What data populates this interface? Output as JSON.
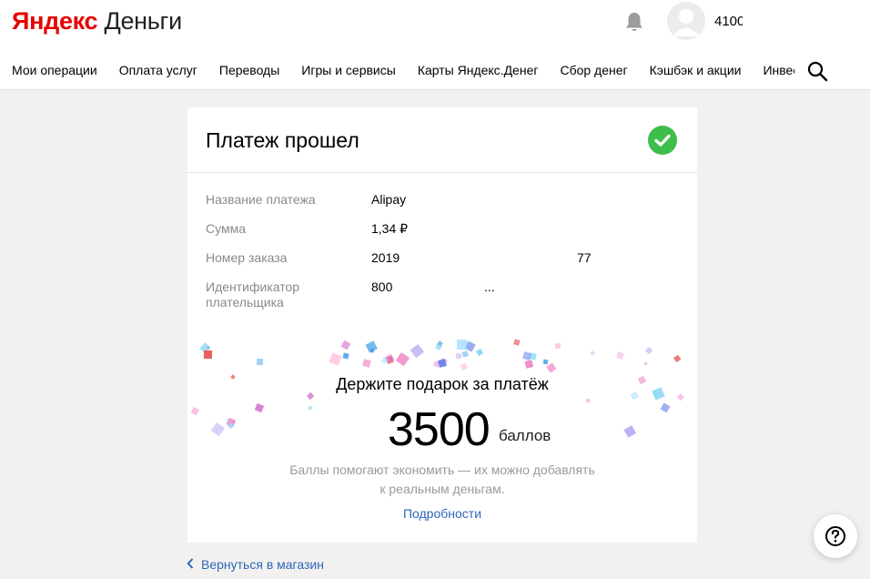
{
  "header": {
    "logo_brand": "Яндекс",
    "logo_product": "Деньги",
    "account_number": "4100",
    "icons": {
      "bell": "bell-icon",
      "avatar": "avatar",
      "search": "search-icon"
    }
  },
  "nav": {
    "items": [
      "Мои операции",
      "Оплата услуг",
      "Переводы",
      "Игры и сервисы",
      "Карты Яндекс.Денег",
      "Сбор денег",
      "Кэшбэк и акции",
      "Инвестиции"
    ]
  },
  "payment": {
    "title": "Платеж прошел",
    "status_icon": "check-circle-icon",
    "status_color": "#3dbd4a",
    "rows": [
      {
        "label": "Название платежа",
        "value": "Alipay"
      },
      {
        "label": "Сумма",
        "value": "1,34 ₽"
      },
      {
        "label": "Номер заказа",
        "value": "2019",
        "extra": "77"
      },
      {
        "label": "Идентификатор плательщика",
        "value": "800",
        "extra": "..."
      }
    ]
  },
  "gift": {
    "title": "Держите подарок за платёж",
    "points": "3500",
    "points_unit": "баллов",
    "description_line1": "Баллы помогают экономить — их можно добавлять",
    "description_line2": "к реальным деньгам.",
    "details_link": "Подробности"
  },
  "footer": {
    "back_link": "Вернуться в магазин"
  },
  "help": {
    "icon": "question-icon"
  },
  "colors": {
    "brand_red": "#e60000",
    "link_blue": "#2e67b9",
    "success_green": "#3dbd4a",
    "background": "#f2f1ef"
  }
}
